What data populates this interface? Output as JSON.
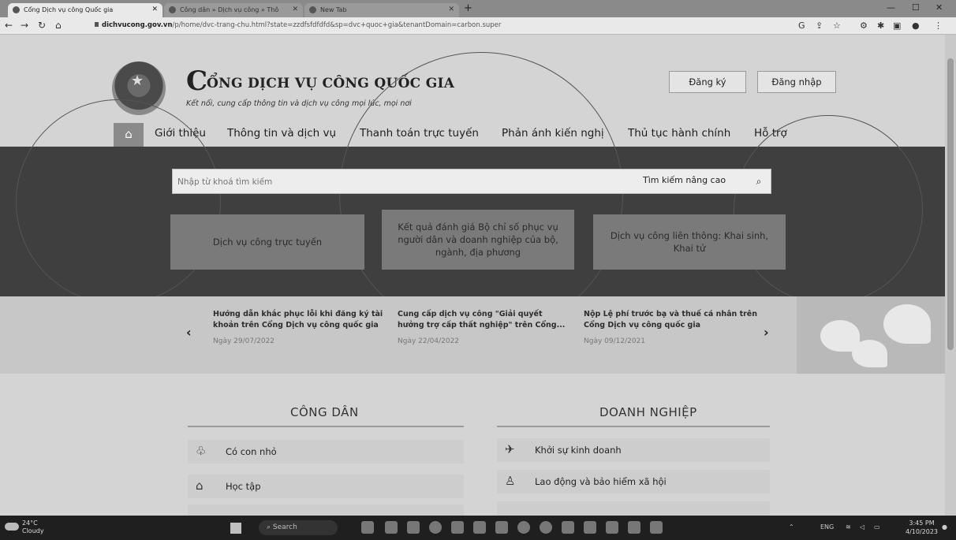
{
  "browser": {
    "tabs": [
      {
        "label": "Cổng Dịch vụ công Quốc gia",
        "active": true
      },
      {
        "label": "Công dân » Dịch vụ công » Thô",
        "active": false
      },
      {
        "label": "New Tab",
        "active": false
      }
    ],
    "url_host": "dichvucong.gov.vn",
    "url_path": "/p/home/dvc-trang-chu.html?state=zzdfsfdfdfd&sp=dvc+quoc+gia&tenantDomain=carbon.super"
  },
  "header": {
    "logo_initial": "C",
    "title": "ỔNG DỊCH VỤ CÔNG QUỐC GIA",
    "subtitle": "Kết nối, cung cấp thông tin và dịch vụ công mọi lúc, mọi nơi",
    "register_label": "Đăng ký",
    "login_label": "Đăng nhập"
  },
  "nav": {
    "items": [
      "Giới thiệu",
      "Thông tin và dịch vụ",
      "Thanh toán trực tuyến",
      "Phản ánh kiến nghị",
      "Thủ tục hành chính",
      "Hỗ trợ"
    ]
  },
  "search": {
    "placeholder": "Nhập từ khoá tìm kiếm",
    "advanced_label": "Tìm kiếm nâng cao"
  },
  "features": [
    "Dịch vụ công trực tuyến",
    "Kết quả đánh giá Bộ chỉ số phục vụ người dân và doanh nghiệp của bộ, ngành, địa phương",
    "Dịch vụ công liên thông: Khai sinh, Khai tử"
  ],
  "news": [
    {
      "title": "Hướng dẫn khắc phục lỗi khi đăng ký tài khoản trên Cổng Dịch vụ công quốc gia",
      "date": "Ngày 29/07/2022"
    },
    {
      "title": "Cung cấp dịch vụ công \"Giải quyết hưởng trợ cấp thất nghiệp\" trên Cổng...",
      "date": "Ngày 22/04/2022"
    },
    {
      "title": "Nộp Lệ phí trước bạ và thuế cá nhân trên Cổng Dịch vụ công quốc gia",
      "date": "Ngày 09/12/2021"
    }
  ],
  "citizen": {
    "title": "CÔNG DÂN",
    "items": [
      "Có con nhỏ",
      "Học tập"
    ]
  },
  "business": {
    "title": "DOANH NGHIỆP",
    "items": [
      "Khởi sự kinh doanh",
      "Lao động và bảo hiểm xã hội"
    ]
  },
  "taskbar": {
    "temperature": "24°C",
    "weather": "Cloudy",
    "search_label": "Search",
    "lang": "ENG",
    "time": "3:45 PM",
    "date": "4/10/2023"
  }
}
